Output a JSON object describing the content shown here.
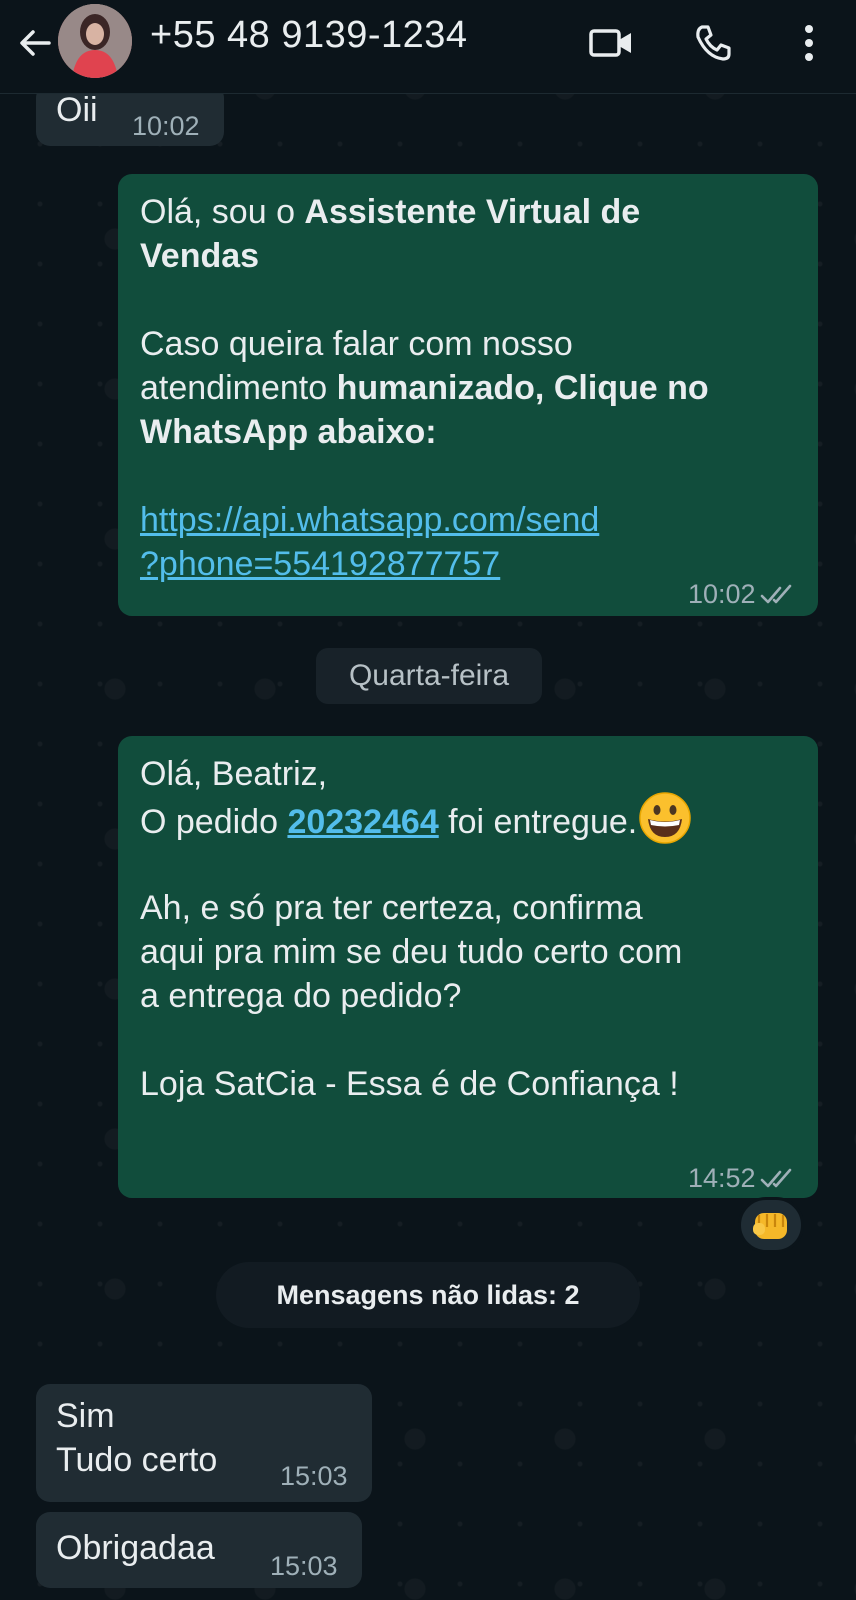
{
  "header": {
    "contact_name": "+55 48 9139-1234",
    "icons": [
      "back-arrow-icon",
      "video-call-icon",
      "phone-icon",
      "more-vertical-icon"
    ]
  },
  "messages": {
    "m1": {
      "text": "Oii",
      "time": "10:02"
    },
    "m2": {
      "l1a": "Olá, sou o ",
      "l1b": "Assistente Virtual de",
      "l2": "Vendas",
      "l3": "Caso queira falar com nosso",
      "l4a": "atendimento ",
      "l4b": "humanizado, Clique no",
      "l5": "WhatsApp abaixo:",
      "link1": "https://api.whatsapp.com/send",
      "link2": "?phone=554192877757",
      "time": "10:02"
    },
    "date_separator": "Quarta-feira",
    "m3": {
      "l1": "Olá, Beatriz,",
      "l2a": "O pedido ",
      "l2_link": "20232464",
      "l2b": " foi entregue.",
      "l3": "Ah, e só pra ter certeza, confirma",
      "l4": "aqui pra mim se deu tudo certo com",
      "l5": "a entrega do pedido?",
      "l6": "Loja SatCia - Essa é de Confiança !",
      "time": "14:52",
      "reaction": "fist-bump-emoji"
    },
    "unread_banner": "Mensagens não lidas: 2",
    "m4": {
      "l1": "Sim",
      "l2": "Tudo certo",
      "time": "15:03"
    },
    "m5": {
      "text": "Obrigadaa",
      "time": "15:03"
    }
  },
  "colors": {
    "background": "#0b141a",
    "incoming_bubble": "#202c33",
    "outgoing_bubble": "#114d3c",
    "link": "#53bdeb",
    "timestamp": "#9fb0b8"
  }
}
